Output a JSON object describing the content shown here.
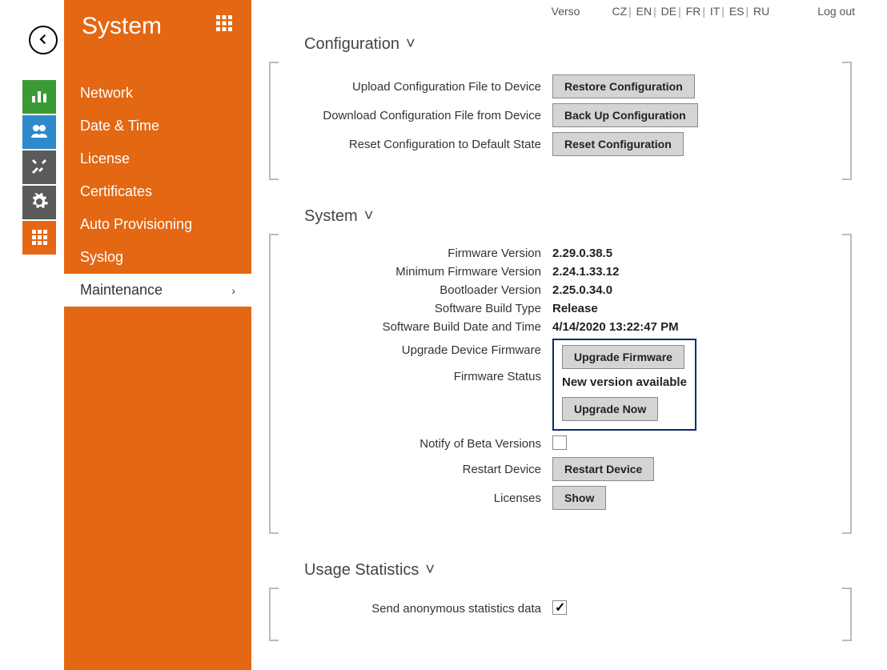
{
  "header": {
    "brand": "Verso",
    "languages": [
      "CZ",
      "EN",
      "DE",
      "FR",
      "IT",
      "ES",
      "RU"
    ],
    "logout": "Log out"
  },
  "iconrail": {
    "icons": [
      "stats",
      "users",
      "tools",
      "gear",
      "grid"
    ],
    "colors": [
      "#3a9a36",
      "#2e8acb",
      "#5a5a5a",
      "#5a5a5a",
      "#e46713"
    ]
  },
  "sidebar": {
    "title": "System",
    "items": [
      {
        "label": "Network"
      },
      {
        "label": "Date & Time"
      },
      {
        "label": "License"
      },
      {
        "label": "Certificates"
      },
      {
        "label": "Auto Provisioning"
      },
      {
        "label": "Syslog"
      },
      {
        "label": "Maintenance",
        "active": true
      }
    ]
  },
  "sections": {
    "configuration": {
      "title": "Configuration",
      "rows": {
        "upload_label": "Upload Configuration File to Device",
        "upload_btn": "Restore Configuration",
        "download_label": "Download Configuration File from Device",
        "download_btn": "Back Up Configuration",
        "reset_label": "Reset Configuration to Default State",
        "reset_btn": "Reset Configuration"
      }
    },
    "system": {
      "title": "System",
      "firmware_version_label": "Firmware Version",
      "firmware_version": "2.29.0.38.5",
      "min_firmware_label": "Minimum Firmware Version",
      "min_firmware": "2.24.1.33.12",
      "bootloader_label": "Bootloader Version",
      "bootloader": "2.25.0.34.0",
      "build_type_label": "Software Build Type",
      "build_type": "Release",
      "build_date_label": "Software Build Date and Time",
      "build_date": "4/14/2020 13:22:47 PM",
      "upgrade_label": "Upgrade Device Firmware",
      "upgrade_btn": "Upgrade Firmware",
      "status_label": "Firmware Status",
      "status_value": "New version available",
      "upgrade_now_btn": "Upgrade Now",
      "notify_label": "Notify of Beta Versions",
      "notify_checked": false,
      "restart_label": "Restart Device",
      "restart_btn": "Restart Device",
      "licenses_label": "Licenses",
      "licenses_btn": "Show"
    },
    "usage": {
      "title": "Usage Statistics",
      "send_label": "Send anonymous statistics data",
      "send_checked": true
    }
  }
}
